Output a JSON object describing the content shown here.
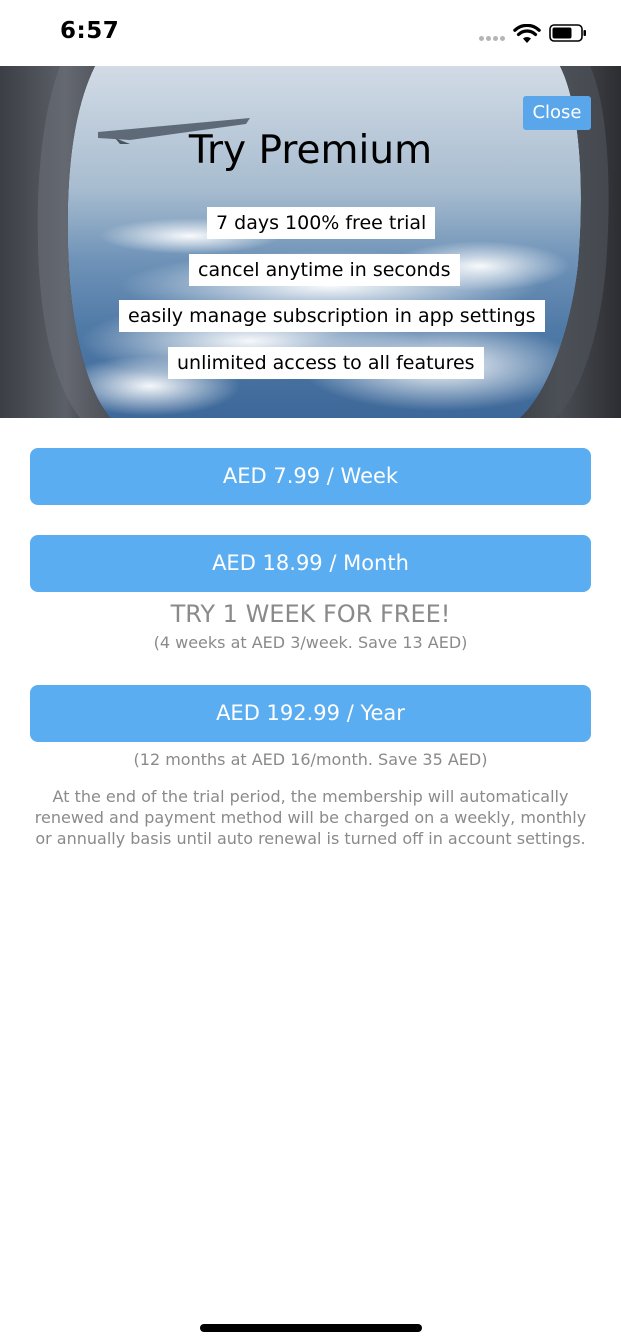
{
  "status_bar": {
    "time": "6:57",
    "icons": [
      "cellular-dots-icon",
      "wifi-icon",
      "battery-icon"
    ]
  },
  "hero": {
    "title": "Try Premium",
    "close_label": "Close",
    "features": [
      "7 days 100% free trial",
      "cancel anytime in seconds",
      "easily manage subscription in app settings",
      "unlimited access to all features"
    ]
  },
  "plans": [
    {
      "label": "AED 7.99 / Week"
    },
    {
      "label": "AED 18.99 / Month",
      "promo_title": "TRY 1 WEEK FOR FREE!",
      "promo_detail": "(4 weeks at AED 3/week. Save 13 AED)"
    },
    {
      "label": "AED 192.99 / Year",
      "promo_detail": "(12 months at AED 16/month. Save 35 AED)"
    }
  ],
  "terms": "At the end of the trial period, the membership will automatically renewed and payment method will be charged on a weekly, monthly or annually basis until auto renewal is turned off in account settings.",
  "colors": {
    "button": "#5badf2",
    "close_button": "#5aa6ea",
    "muted_text": "#8a8a8a"
  }
}
